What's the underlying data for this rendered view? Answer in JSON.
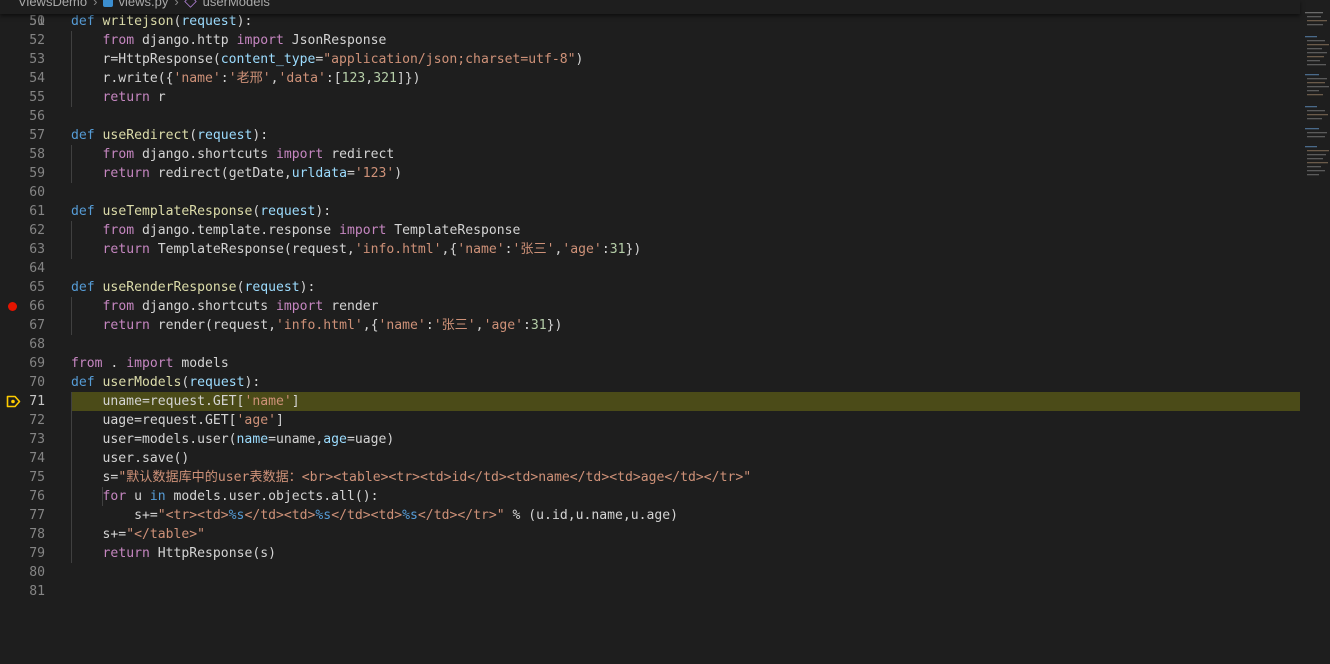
{
  "breadcrumb": {
    "folder": "ViewsDemo",
    "file": "views.py",
    "symbol": "userModels"
  },
  "editor": {
    "partial_top_line_number": "50",
    "current_line": "71",
    "breakpoint_line": "66"
  },
  "colors": {
    "background": "#1e1e1e",
    "current_line_highlight": "#4b4b18",
    "breakpoint": "#e51400",
    "execution_arrow": "#ffcc00"
  },
  "lines": [
    {
      "num": "51",
      "tokens": [
        {
          "t": "def ",
          "c": "k"
        },
        {
          "t": "writejson",
          "c": "f"
        },
        {
          "t": "("
        },
        {
          "t": "request",
          "c": "p"
        },
        {
          "t": "):"
        }
      ]
    },
    {
      "num": "52",
      "tokens": [
        {
          "t": "    "
        },
        {
          "t": "from",
          "c": "i"
        },
        {
          "t": " django.http "
        },
        {
          "t": "import",
          "c": "i"
        },
        {
          "t": " JsonResponse"
        }
      ]
    },
    {
      "num": "53",
      "tokens": [
        {
          "t": "    r=HttpResponse("
        },
        {
          "t": "content_type",
          "c": "p"
        },
        {
          "t": "="
        },
        {
          "t": "\"application/json;charset=utf-8\"",
          "c": "s"
        },
        {
          "t": ")"
        }
      ]
    },
    {
      "num": "54",
      "tokens": [
        {
          "t": "    r.write({"
        },
        {
          "t": "'name'",
          "c": "s"
        },
        {
          "t": ":"
        },
        {
          "t": "'老邢'",
          "c": "s"
        },
        {
          "t": ","
        },
        {
          "t": "'data'",
          "c": "s"
        },
        {
          "t": ":["
        },
        {
          "t": "123",
          "c": "n"
        },
        {
          "t": ","
        },
        {
          "t": "321",
          "c": "n"
        },
        {
          "t": "]})"
        }
      ]
    },
    {
      "num": "55",
      "tokens": [
        {
          "t": "    "
        },
        {
          "t": "return",
          "c": "i"
        },
        {
          "t": " r"
        }
      ]
    },
    {
      "num": "56",
      "tokens": []
    },
    {
      "num": "57",
      "tokens": [
        {
          "t": "def ",
          "c": "k"
        },
        {
          "t": "useRedirect",
          "c": "f"
        },
        {
          "t": "("
        },
        {
          "t": "request",
          "c": "p"
        },
        {
          "t": "):"
        }
      ]
    },
    {
      "num": "58",
      "tokens": [
        {
          "t": "    "
        },
        {
          "t": "from",
          "c": "i"
        },
        {
          "t": " django.shortcuts "
        },
        {
          "t": "import",
          "c": "i"
        },
        {
          "t": " redirect"
        }
      ]
    },
    {
      "num": "59",
      "tokens": [
        {
          "t": "    "
        },
        {
          "t": "return",
          "c": "i"
        },
        {
          "t": " redirect(getDate,"
        },
        {
          "t": "urldata",
          "c": "p"
        },
        {
          "t": "="
        },
        {
          "t": "'123'",
          "c": "s"
        },
        {
          "t": ")"
        }
      ]
    },
    {
      "num": "60",
      "tokens": []
    },
    {
      "num": "61",
      "tokens": [
        {
          "t": "def ",
          "c": "k"
        },
        {
          "t": "useTemplateResponse",
          "c": "f"
        },
        {
          "t": "("
        },
        {
          "t": "request",
          "c": "p"
        },
        {
          "t": "):"
        }
      ]
    },
    {
      "num": "62",
      "tokens": [
        {
          "t": "    "
        },
        {
          "t": "from",
          "c": "i"
        },
        {
          "t": " django.template.response "
        },
        {
          "t": "import",
          "c": "i"
        },
        {
          "t": " TemplateResponse"
        }
      ]
    },
    {
      "num": "63",
      "tokens": [
        {
          "t": "    "
        },
        {
          "t": "return",
          "c": "i"
        },
        {
          "t": " TemplateResponse(request,"
        },
        {
          "t": "'info.html'",
          "c": "s"
        },
        {
          "t": ",{"
        },
        {
          "t": "'name'",
          "c": "s"
        },
        {
          "t": ":"
        },
        {
          "t": "'张三'",
          "c": "s"
        },
        {
          "t": ","
        },
        {
          "t": "'age'",
          "c": "s"
        },
        {
          "t": ":"
        },
        {
          "t": "31",
          "c": "n"
        },
        {
          "t": "})"
        }
      ]
    },
    {
      "num": "64",
      "tokens": []
    },
    {
      "num": "65",
      "tokens": [
        {
          "t": "def ",
          "c": "k"
        },
        {
          "t": "useRenderResponse",
          "c": "f"
        },
        {
          "t": "("
        },
        {
          "t": "request",
          "c": "p"
        },
        {
          "t": "):"
        }
      ]
    },
    {
      "num": "66",
      "tokens": [
        {
          "t": "    "
        },
        {
          "t": "from",
          "c": "i"
        },
        {
          "t": " django.shortcuts "
        },
        {
          "t": "import",
          "c": "i"
        },
        {
          "t": " render"
        }
      ]
    },
    {
      "num": "67",
      "tokens": [
        {
          "t": "    "
        },
        {
          "t": "return",
          "c": "i"
        },
        {
          "t": " render(request,"
        },
        {
          "t": "'info.html'",
          "c": "s"
        },
        {
          "t": ",{"
        },
        {
          "t": "'name'",
          "c": "s"
        },
        {
          "t": ":"
        },
        {
          "t": "'张三'",
          "c": "s"
        },
        {
          "t": ","
        },
        {
          "t": "'age'",
          "c": "s"
        },
        {
          "t": ":"
        },
        {
          "t": "31",
          "c": "n"
        },
        {
          "t": "})"
        }
      ]
    },
    {
      "num": "68",
      "tokens": []
    },
    {
      "num": "69",
      "tokens": [
        {
          "t": "from",
          "c": "i"
        },
        {
          "t": " . "
        },
        {
          "t": "import",
          "c": "i"
        },
        {
          "t": " models"
        }
      ]
    },
    {
      "num": "70",
      "tokens": [
        {
          "t": "def ",
          "c": "k"
        },
        {
          "t": "userModels",
          "c": "f"
        },
        {
          "t": "("
        },
        {
          "t": "request",
          "c": "p"
        },
        {
          "t": "):"
        }
      ]
    },
    {
      "num": "71",
      "tokens": [
        {
          "t": "    uname=request.GET["
        },
        {
          "t": "'name'",
          "c": "s"
        },
        {
          "t": "]"
        }
      ]
    },
    {
      "num": "72",
      "tokens": [
        {
          "t": "    uage=request.GET["
        },
        {
          "t": "'age'",
          "c": "s"
        },
        {
          "t": "]"
        }
      ]
    },
    {
      "num": "73",
      "tokens": [
        {
          "t": "    user=models.user("
        },
        {
          "t": "name",
          "c": "p"
        },
        {
          "t": "=uname,"
        },
        {
          "t": "age",
          "c": "p"
        },
        {
          "t": "=uage)"
        }
      ]
    },
    {
      "num": "74",
      "tokens": [
        {
          "t": "    user.save()"
        }
      ]
    },
    {
      "num": "75",
      "tokens": [
        {
          "t": "    s="
        },
        {
          "t": "\"默认数据库中的user表数据：<br><table><tr><td>id</td><td>name</td><td>age</td></tr>\"",
          "c": "s"
        }
      ]
    },
    {
      "num": "76",
      "tokens": [
        {
          "t": "    "
        },
        {
          "t": "for",
          "c": "i"
        },
        {
          "t": " u "
        },
        {
          "t": "in",
          "c": "k"
        },
        {
          "t": " models.user.objects.all():"
        }
      ]
    },
    {
      "num": "77",
      "tokens": [
        {
          "t": "        s+="
        },
        {
          "t": "\"<tr><td>",
          "c": "s"
        },
        {
          "t": "%s",
          "c": "k"
        },
        {
          "t": "</td><td>",
          "c": "s"
        },
        {
          "t": "%s",
          "c": "k"
        },
        {
          "t": "</td><td>",
          "c": "s"
        },
        {
          "t": "%s",
          "c": "k"
        },
        {
          "t": "</td></tr>\"",
          "c": "s"
        },
        {
          "t": " % (u.id,u.name,u.age)"
        }
      ]
    },
    {
      "num": "78",
      "tokens": [
        {
          "t": "    s+="
        },
        {
          "t": "\"</table>\"",
          "c": "s"
        }
      ]
    },
    {
      "num": "79",
      "tokens": [
        {
          "t": "    "
        },
        {
          "t": "return",
          "c": "i"
        },
        {
          "t": " HttpResponse(s)"
        }
      ]
    },
    {
      "num": "80",
      "tokens": []
    },
    {
      "num": "81",
      "tokens": []
    }
  ]
}
